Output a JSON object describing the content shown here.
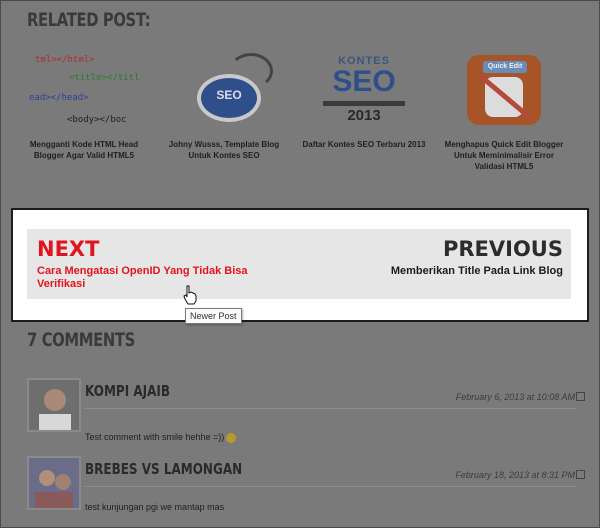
{
  "related": {
    "title": "RELATED POST:",
    "items": [
      {
        "caption": "Mengganti Kode HTML Head Blogger Agar Valid HTML5",
        "code_lines": [
          "tml></html>",
          "<title></title>",
          "ead></head>",
          "<body></boc"
        ]
      },
      {
        "caption": "Johny Wusss, Template Blog Untuk Kontes SEO",
        "screen_text": "SEO"
      },
      {
        "caption": "Daftar Kontes SEO Terbaru 2013",
        "top_text": "KONTES",
        "big_text": "SEO",
        "year_text": "2013"
      },
      {
        "caption": "Menghapus Quick Edit Blogger Untuk Meminimalisir Error Validasi HTML5",
        "label_text": "Quick Edit"
      }
    ]
  },
  "nav": {
    "next_label": "NEXT",
    "next_post": "Cara Mengatasi OpenID Yang Tidak Bisa Verifikasi",
    "prev_label": "PREVIOUS",
    "prev_post": "Memberikan Title Pada Link Blog",
    "tooltip": "Newer Post"
  },
  "comments": {
    "title": "7 COMMENTS",
    "items": [
      {
        "author": "KOMPI AJAIB",
        "date": "February 6, 2013 at 10:08 AM",
        "text": "Test comment with smile hehhe =))"
      },
      {
        "author": "BREBES VS LAMONGAN",
        "date": "February 18, 2013 at 8:31 PM",
        "text": "test kunjungan pgi we mantap mas"
      }
    ]
  },
  "colors": {
    "accent": "#e0141e",
    "overlay": "#7a7a7a"
  }
}
